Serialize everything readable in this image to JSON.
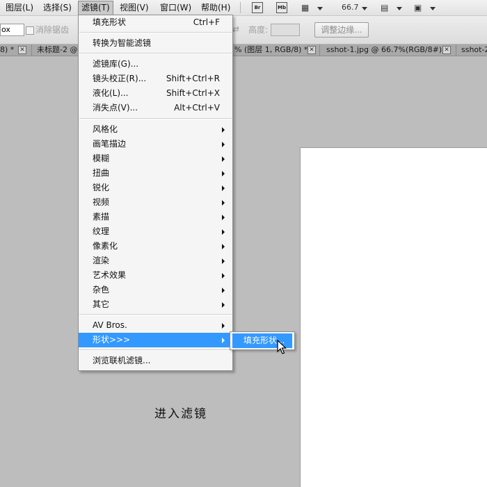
{
  "menubar": {
    "items": [
      "图层(L)",
      "选择(S)",
      "滤镜(T)",
      "视图(V)",
      "窗口(W)",
      "帮助(H)"
    ],
    "active": "滤镜(T)",
    "bridge_badge": "Br",
    "minibridge_badge": "Mb",
    "zoom": "66.7"
  },
  "options": {
    "input_value": "ox",
    "antialias_label": "消除锯齿",
    "height_label": "高度:",
    "refine_button": "调整边缘..."
  },
  "tabs": [
    {
      "label": "8) *"
    },
    {
      "label": "未标题-2 @"
    },
    {
      "label": "% (图层 1, RGB/8) *"
    },
    {
      "label": "sshot-1.jpg @ 66.7%(RGB/8#)"
    },
    {
      "label": "sshot-2"
    }
  ],
  "filter_menu": {
    "last_filter": {
      "label": "填充形状",
      "shortcut": "Ctrl+F"
    },
    "smart_filter": "转换为智能滤镜",
    "gallery": {
      "label": "滤镜库(G)..."
    },
    "lens": {
      "label": "镜头校正(R)...",
      "shortcut": "Shift+Ctrl+R"
    },
    "liquify": {
      "label": "液化(L)...",
      "shortcut": "Shift+Ctrl+X"
    },
    "vanishing": {
      "label": "消失点(V)...",
      "shortcut": "Alt+Ctrl+V"
    },
    "groups": [
      "风格化",
      "画笔描边",
      "模糊",
      "扭曲",
      "锐化",
      "视频",
      "素描",
      "纹理",
      "像素化",
      "渲染",
      "艺术效果",
      "杂色",
      "其它"
    ],
    "av_bros": "AV Bros.",
    "shapes": "形状>>>",
    "browse_online": "浏览联机滤镜..."
  },
  "submenu": {
    "item": "填充形状..."
  },
  "caption": "进入滤镜",
  "colors": {
    "highlight": "#3399ff",
    "workspace": "#bdbdbd",
    "canvas": "#ffffff"
  }
}
